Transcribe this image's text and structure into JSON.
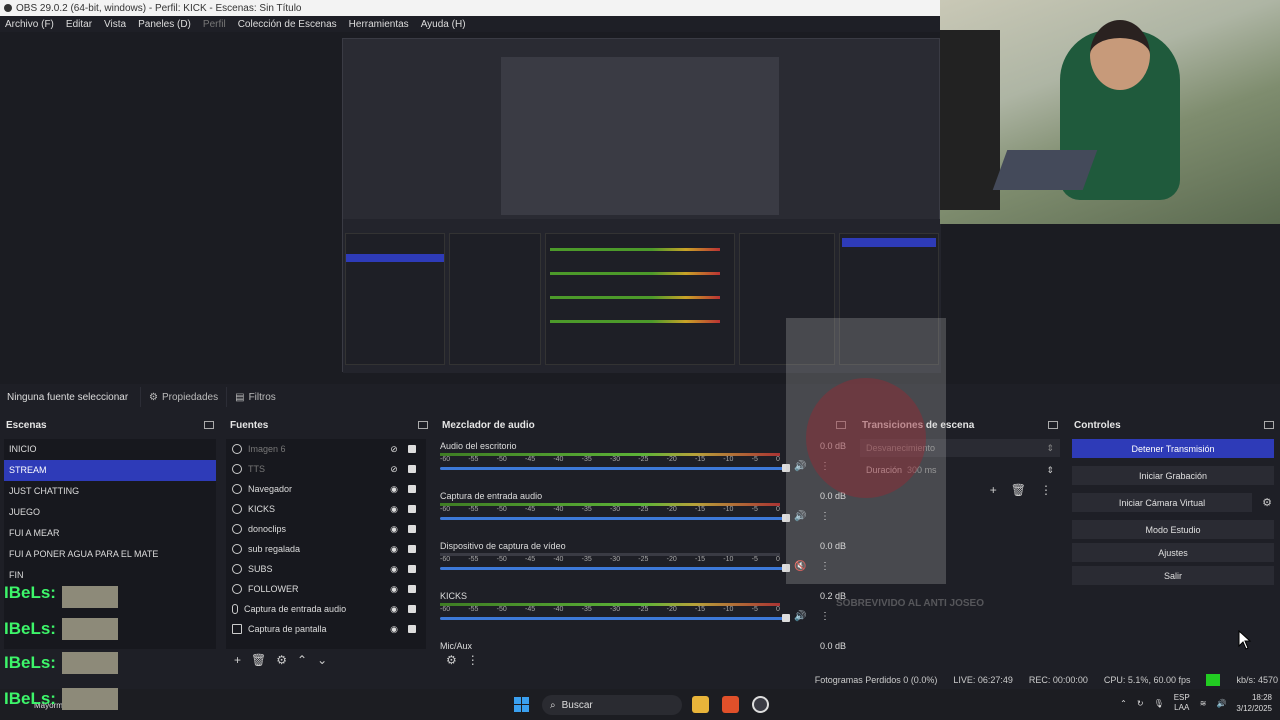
{
  "window": {
    "title": "OBS 29.0.2 (64-bit, windows) - Perfil: KICK - Escenas: Sin Título"
  },
  "menu": {
    "items": [
      "Archivo (F)",
      "Editar",
      "Vista",
      "Paneles (D)",
      "Perfil",
      "Colección de Escenas",
      "Herramientas",
      "Ayuda (H)"
    ]
  },
  "sourcebar": {
    "no_selection": "Ninguna fuente seleccionar",
    "properties": "Propiedades",
    "filters": "Filtros"
  },
  "scenes": {
    "title": "Escenas",
    "items": [
      "INICIO",
      "STREAM",
      "JUST CHATTING",
      "JUEGO",
      "FUI A MEAR",
      "FUI A PONER AGUA PARA EL MATE",
      "FIN"
    ],
    "selected": "STREAM"
  },
  "sources": {
    "title": "Fuentes",
    "items": [
      {
        "name": "Imagen 6",
        "type": "image",
        "visible": false
      },
      {
        "name": "TTS",
        "type": "browser",
        "visible": false
      },
      {
        "name": "Navegador",
        "type": "browser",
        "visible": true
      },
      {
        "name": "KICKS",
        "type": "browser",
        "visible": true
      },
      {
        "name": "donoclips",
        "type": "browser",
        "visible": true
      },
      {
        "name": "sub regalada",
        "type": "browser",
        "visible": true
      },
      {
        "name": "SUBS",
        "type": "browser",
        "visible": true
      },
      {
        "name": "FOLLOWER",
        "type": "browser",
        "visible": true
      },
      {
        "name": "Captura de entrada audio",
        "type": "mic",
        "visible": true
      },
      {
        "name": "Captura de pantalla",
        "type": "monitor",
        "visible": true
      }
    ]
  },
  "mixer": {
    "title": "Mezclador de audio",
    "ticks": [
      "-60",
      "-55",
      "-50",
      "-45",
      "-40",
      "-35",
      "-30",
      "-25",
      "-20",
      "-15",
      "-10",
      "-5",
      "0"
    ],
    "channels": [
      {
        "name": "Audio del escritorio",
        "db": "0.0 dB"
      },
      {
        "name": "Captura de entrada audio",
        "db": "0.0 dB"
      },
      {
        "name": "Dispositivo de captura de vídeo",
        "db": "0.0 dB"
      },
      {
        "name": "KICKS",
        "db": "0.2 dB"
      },
      {
        "name": "Mic/Aux",
        "db": "0.0 dB"
      }
    ]
  },
  "transitions": {
    "title": "Transiciones de escena",
    "transition": "Desvanecimiento",
    "duration_label": "Duración",
    "duration": "300 ms"
  },
  "controls": {
    "title": "Controles",
    "buttons": [
      "Detener Transmisión",
      "Iniciar Grabación",
      "Iniciar Cámara Virtual",
      "Modo Estudio",
      "Ajustes",
      "Salir"
    ]
  },
  "status": {
    "dropped": "Fotogramas Perdidos 0 (0.0%)",
    "live": "LIVE: 06:27:49",
    "rec": "REC: 00:00:00",
    "cpu": "CPU: 5.1%, 60.00 fps",
    "kbps": "kb/s: 4570"
  },
  "overlay": {
    "kick_label": "IBeLs:",
    "caption": "SOBREVIVIDO AL ANTI JOSEO"
  },
  "taskbar": {
    "search": "Buscar",
    "lang1": "ESP",
    "lang2": "LAA",
    "time": "18:28",
    "date": "3/12/2025",
    "bottom_left": "Mayorm"
  },
  "colors": {
    "accent": "#2e3bb8",
    "background": "#1e1f26",
    "live_indicator": "#22cc22"
  }
}
